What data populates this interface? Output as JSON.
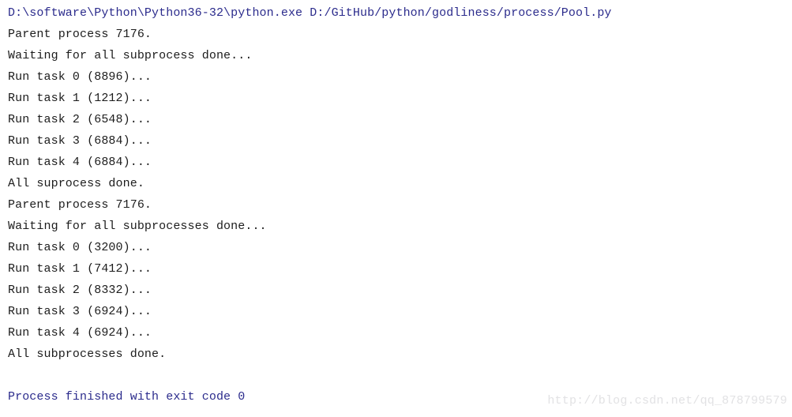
{
  "console": {
    "background_color": "#ffffff",
    "command_color": "#2b2b8c",
    "output_color": "#1c1c1c",
    "watermark_color": "#e2e2e4",
    "lines": [
      {
        "text": "D:\\software\\Python\\Python36-32\\python.exe D:/GitHub/python/godliness/process/Pool.py",
        "kind": "cmd"
      },
      {
        "text": "Parent process 7176.",
        "kind": "output"
      },
      {
        "text": "Waiting for all subprocess done...",
        "kind": "output"
      },
      {
        "text": "Run task 0 (8896)...",
        "kind": "output"
      },
      {
        "text": "Run task 1 (1212)...",
        "kind": "output"
      },
      {
        "text": "Run task 2 (6548)...",
        "kind": "output"
      },
      {
        "text": "Run task 3 (6884)...",
        "kind": "output"
      },
      {
        "text": "Run task 4 (6884)...",
        "kind": "output"
      },
      {
        "text": "All suprocess done.",
        "kind": "output"
      },
      {
        "text": "Parent process 7176.",
        "kind": "output"
      },
      {
        "text": "Waiting for all subprocesses done...",
        "kind": "output"
      },
      {
        "text": "Run task 0 (3200)...",
        "kind": "output"
      },
      {
        "text": "Run task 1 (7412)...",
        "kind": "output"
      },
      {
        "text": "Run task 2 (8332)...",
        "kind": "output"
      },
      {
        "text": "Run task 3 (6924)...",
        "kind": "output"
      },
      {
        "text": "Run task 4 (6924)...",
        "kind": "output"
      },
      {
        "text": "All subprocesses done.",
        "kind": "output"
      },
      {
        "text": " ",
        "kind": "blank"
      },
      {
        "text": "Process finished with exit code 0",
        "kind": "exit"
      }
    ]
  },
  "watermark": {
    "text": "http://blog.csdn.net/qq_878799579"
  }
}
